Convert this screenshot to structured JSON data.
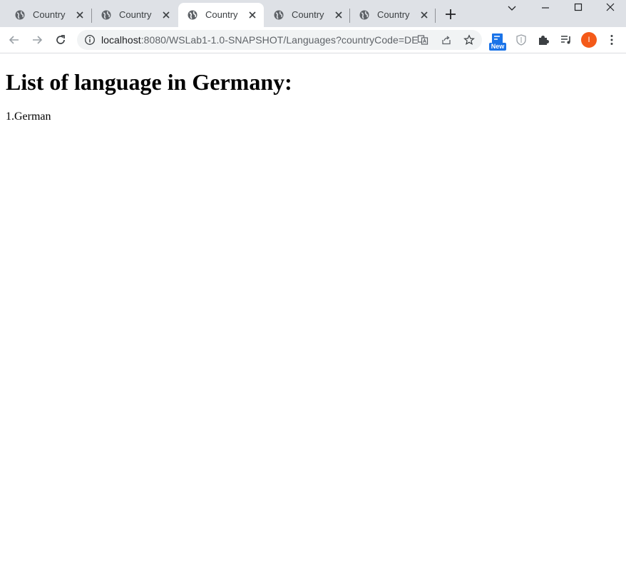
{
  "tabs": [
    {
      "title": "Country",
      "active": false
    },
    {
      "title": "Country",
      "active": false
    },
    {
      "title": "Country",
      "active": true
    },
    {
      "title": "Country",
      "active": false
    },
    {
      "title": "Country",
      "active": false
    }
  ],
  "address_bar": {
    "host": "localhost",
    "rest": ":8080/WSLab1-1.0-SNAPSHOT/Languages?countryCode=DE"
  },
  "extension_badge": "New",
  "profile_initial": "I",
  "page": {
    "heading": "List of language in Germany:",
    "languages": [
      "1.German"
    ]
  },
  "colors": {
    "tabstrip": "#dee1e6",
    "avatar": "#f45a19",
    "badge": "#1a73e8"
  },
  "icons": {
    "favicon": "globe-icon",
    "close": "close-icon",
    "new_tab": "plus-icon",
    "back": "back-arrow-icon",
    "forward": "forward-arrow-icon",
    "reload": "reload-icon",
    "site_info": "info-icon",
    "translate": "translate-icon",
    "share": "share-icon",
    "bookmark": "star-icon",
    "extensions": "puzzle-icon",
    "media": "media-playlist-icon",
    "menu": "kebab-menu-icon",
    "tab_search": "chevron-down-icon",
    "minimize": "minimize-icon",
    "maximize": "maximize-icon",
    "window_close": "window-close-icon"
  }
}
